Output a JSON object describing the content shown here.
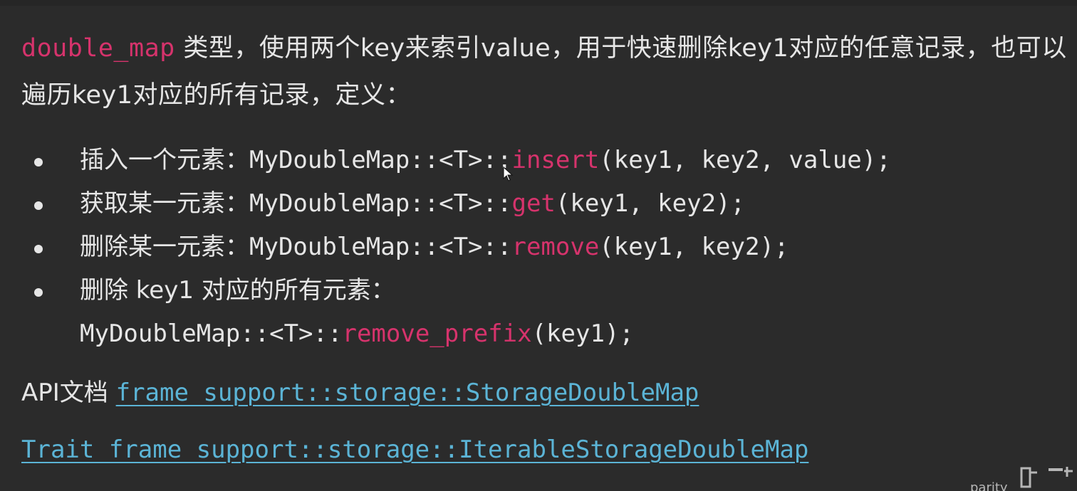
{
  "intro": {
    "code_term": "double_map",
    "text": " 类型，使用两个key来索引value，用于快速删除key1对应的任意记录，也可以遍历key1对应的所有记录，定义："
  },
  "methods": [
    {
      "label": "插入一个元素：",
      "prefix": "MyDoubleMap::<T>::",
      "func": "insert",
      "args": "(key1, key2, value);"
    },
    {
      "label": "获取某一元素：",
      "prefix": "MyDoubleMap::<T>::",
      "func": "get",
      "args": "(key1, key2);"
    },
    {
      "label": "删除某一元素：",
      "prefix": "MyDoubleMap::<T>::",
      "func": "remove",
      "args": "(key1, key2);"
    },
    {
      "label": "删除 key1 对应的所有元素：",
      "prefix": "MyDoubleMap::<T>::",
      "func": "remove_prefix",
      "args": "(key1);"
    }
  ],
  "api": {
    "label": "API文档 ",
    "link": "frame_support::storage::StorageDoubleMap"
  },
  "trait": {
    "link": "Trait frame_support::storage::IterableStorageDoubleMap"
  },
  "watermark": {
    "brand": "parity"
  },
  "colors": {
    "background": "#2b2b2b",
    "text": "#e6e6e6",
    "code_highlight": "#d6336c",
    "link": "#5bb4d6"
  },
  "icons": [
    "bullet",
    "mouse-pointer-icon",
    "logo-icon"
  ]
}
